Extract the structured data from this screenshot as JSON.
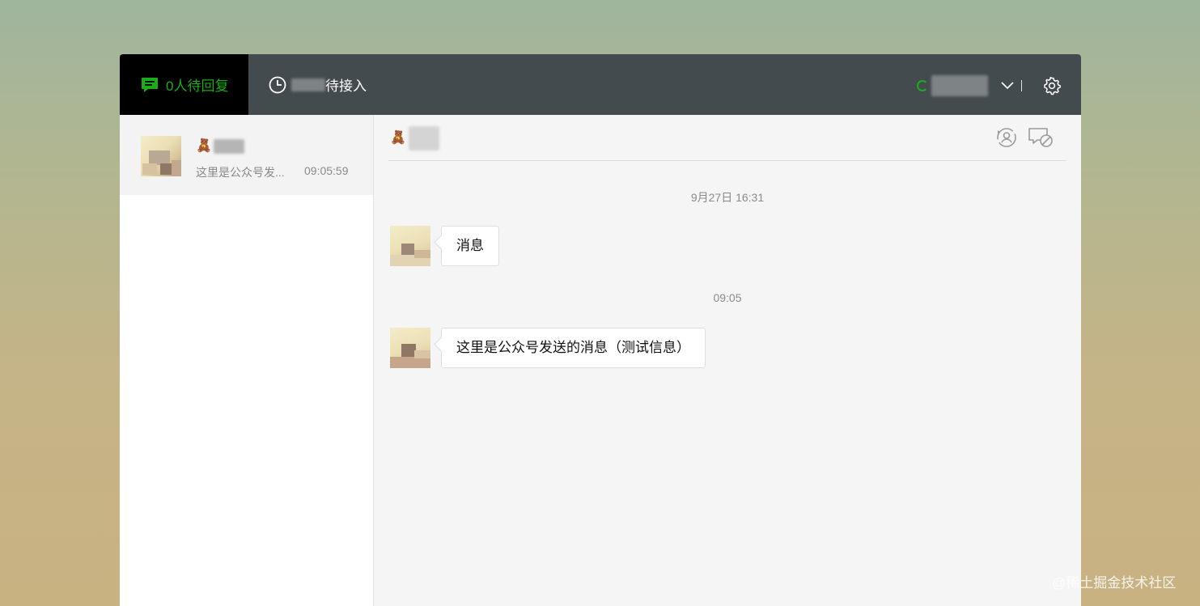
{
  "topbar": {
    "pending_tab": {
      "label": "0人待回复",
      "icon": "chat-bubble-icon",
      "color": "#1aad19"
    },
    "waiting_tab": {
      "label": "待接入",
      "icon": "clock-icon"
    },
    "account": {
      "status_color": "#1aad19",
      "icon": "chevron-down-icon"
    },
    "settings_icon": "gear-icon"
  },
  "sidebar": {
    "sessions": [
      {
        "preview": "这里是公众号发...",
        "time": "09:05:59"
      }
    ]
  },
  "chat": {
    "header_icons": [
      "transfer-user-icon",
      "close-chat-icon"
    ],
    "timeline": [
      {
        "time": "9月27日 16:31",
        "message": "消息"
      },
      {
        "time": "09:05",
        "message": "这里是公众号发送的消息（测试信息）"
      }
    ]
  },
  "watermark": "@稀土掘金技术社区"
}
